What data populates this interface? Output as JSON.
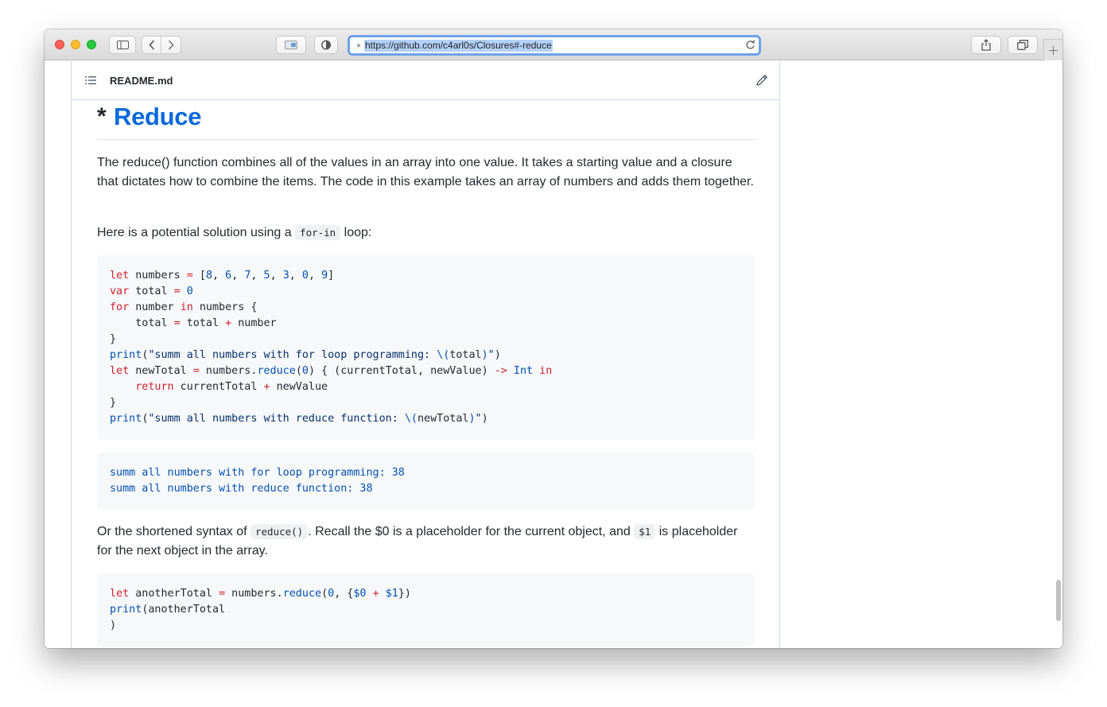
{
  "browser": {
    "url": "https://github.com/c4arl0s/Closures#-reduce",
    "buttons": {
      "sidebar": "sidebar-toggle",
      "back": "‹",
      "forward": "›",
      "reader": "reader",
      "privacy": "privacy",
      "share": "share",
      "tabs": "tabs",
      "new_tab": "+"
    }
  },
  "readme": {
    "filename": "README.md",
    "heading_prefix": "*",
    "heading": "Reduce",
    "paragraph1": "The reduce() function combines all of the values in an array into one value. It takes a starting value and a closure that dictates how to combine the items. The code in this example takes an array of numbers and adds them together.",
    "paragraph2_before": "Here is a potential solution using a ",
    "paragraph2_code": "for-in",
    "paragraph2_after": " loop:",
    "paragraph3_before": "Or the shortened syntax of ",
    "paragraph3_code1": "reduce()",
    "paragraph3_middle": ". Recall the $0 is a placeholder for the current object, and ",
    "paragraph3_code2": "$1",
    "paragraph3_after": " is placeholder for the next object in the array.",
    "code1": {
      "l1": {
        "kw": "let",
        "a": " numbers ",
        "op": "=",
        "b": " [",
        "n1": "8",
        "c1": ", ",
        "n2": "6",
        "c2": ", ",
        "n3": "7",
        "c3": ", ",
        "n4": "5",
        "c4": ", ",
        "n5": "3",
        "c5": ", ",
        "n6": "0",
        "c6": ", ",
        "n7": "9",
        "end": "]"
      },
      "l2": {
        "kw": "var",
        "a": " total ",
        "op": "=",
        "n": " 0"
      },
      "l3": {
        "kw": "for",
        "a": " number ",
        "kw2": "in",
        "b": " numbers {"
      },
      "l4": {
        "a": "    total ",
        "op": "=",
        "b": " total ",
        "op2": "+",
        "c": " number"
      },
      "l5": "}",
      "l6": {
        "fn": "print",
        "a": "(",
        "s": "\"summ all numbers with for loop programming: ",
        "interp": "\\(",
        "v": "total",
        "ie": ")",
        "s2": "\"",
        "end": ")"
      },
      "l7": {
        "kw": "let",
        "a": " newTotal ",
        "op": "=",
        "b": " numbers.",
        "fn": "reduce",
        "c": "(",
        "n": "0",
        "d": ") { (currentTotal, newValue) ",
        "arr": "->",
        "sp": " ",
        "type": "Int",
        "sp2": " ",
        "kw2": "in"
      },
      "l8": {
        "pad": "    ",
        "kw": "return",
        "a": " currentTotal ",
        "op": "+",
        "b": " newValue"
      },
      "l9": "}",
      "l10": {
        "fn": "print",
        "a": "(",
        "s": "\"summ all numbers with reduce function: ",
        "interp": "\\(",
        "v": "newTotal",
        "ie": ")",
        "s2": "\"",
        "end": ")"
      }
    },
    "output": {
      "l1": "summ all numbers with for loop programming: 38",
      "l2": "summ all numbers with reduce function: 38"
    },
    "code2": {
      "l1": {
        "kw": "let",
        "a": " anotherTotal ",
        "op": "=",
        "b": " numbers.",
        "fn": "reduce",
        "c": "(",
        "n": "0",
        "d": ", {",
        "v1": "$0",
        "sp": " ",
        "op2": "+",
        "sp2": " ",
        "v2": "$1",
        "end": "})"
      },
      "l2": {
        "fn": "print",
        "a": "(anotherTotal"
      },
      "l3": ")"
    }
  }
}
